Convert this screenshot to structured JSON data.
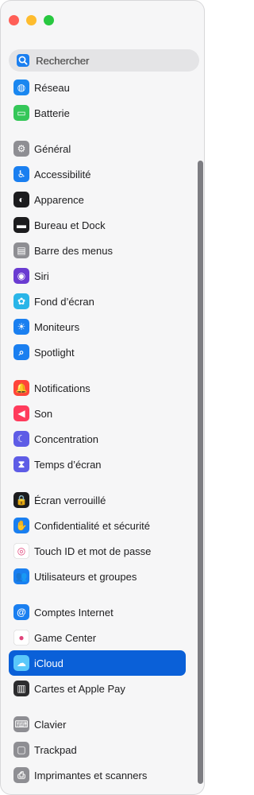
{
  "search": {
    "placeholder": "Rechercher",
    "icon": "magnifier-icon"
  },
  "groups": [
    [
      {
        "name": "reseau",
        "label": "Réseau",
        "icon": "globe-icon",
        "color": "#1a87f0"
      },
      {
        "name": "batterie",
        "label": "Batterie",
        "icon": "battery-icon",
        "color": "#35c759"
      }
    ],
    [
      {
        "name": "general",
        "label": "Général",
        "icon": "gear-icon",
        "color": "#8e8e93"
      },
      {
        "name": "accessibilite",
        "label": "Accessibilité",
        "icon": "accessibility-icon",
        "color": "#1a7ff0"
      },
      {
        "name": "apparence",
        "label": "Apparence",
        "icon": "appearance-icon",
        "color": "#1c1c1e"
      },
      {
        "name": "bureau-et-dock",
        "label": "Bureau et Dock",
        "icon": "dock-icon",
        "color": "#1c1c1e"
      },
      {
        "name": "barre-des-menus",
        "label": "Barre des menus",
        "icon": "menubar-icon",
        "color": "#8e8e93"
      },
      {
        "name": "siri",
        "label": "Siri",
        "icon": "siri-icon",
        "color": "#6a3bd1"
      },
      {
        "name": "fond-d-ecran",
        "label": "Fond d’écran",
        "icon": "wallpaper-icon",
        "color": "#2ab5e8"
      },
      {
        "name": "moniteurs",
        "label": "Moniteurs",
        "icon": "sun-icon",
        "color": "#1a7ff0"
      },
      {
        "name": "spotlight",
        "label": "Spotlight",
        "icon": "search-icon",
        "color": "#1a7ff0"
      }
    ],
    [
      {
        "name": "notifications",
        "label": "Notifications",
        "icon": "bell-icon",
        "color": "#ff453a"
      },
      {
        "name": "son",
        "label": "Son",
        "icon": "speaker-icon",
        "color": "#ff3b5c"
      },
      {
        "name": "concentration",
        "label": "Concentration",
        "icon": "moon-icon",
        "color": "#5e5ce6"
      },
      {
        "name": "temps-d-ecran",
        "label": "Temps d’écran",
        "icon": "hourglass-icon",
        "color": "#5e5ce6"
      }
    ],
    [
      {
        "name": "ecran-verrouille",
        "label": "Écran verrouillé",
        "icon": "lock-icon",
        "color": "#1c1c1e"
      },
      {
        "name": "confidentialite",
        "label": "Confidentialité et sécurité",
        "icon": "hand-icon",
        "color": "#1a7ff0"
      },
      {
        "name": "touch-id",
        "label": "Touch ID et mot de passe",
        "icon": "fingerprint-icon",
        "color": "#ffffff"
      },
      {
        "name": "utilisateurs",
        "label": "Utilisateurs et groupes",
        "icon": "users-icon",
        "color": "#1a7ff0"
      }
    ],
    [
      {
        "name": "comptes-internet",
        "label": "Comptes Internet",
        "icon": "at-icon",
        "color": "#1a7ff0"
      },
      {
        "name": "game-center",
        "label": "Game Center",
        "icon": "game-center-icon",
        "color": "#ffffff"
      },
      {
        "name": "icloud",
        "label": "iCloud",
        "icon": "cloud-icon",
        "color": "#5ac8fa",
        "selected": true
      },
      {
        "name": "cartes-apple-pay",
        "label": "Cartes et Apple Pay",
        "icon": "wallet-icon",
        "color": "#2c2c2e"
      }
    ],
    [
      {
        "name": "clavier",
        "label": "Clavier",
        "icon": "keyboard-icon",
        "color": "#8e8e93"
      },
      {
        "name": "trackpad",
        "label": "Trackpad",
        "icon": "trackpad-icon",
        "color": "#8e8e93"
      },
      {
        "name": "imprimantes",
        "label": "Imprimantes et scanners",
        "icon": "printer-icon",
        "color": "#8e8e93"
      }
    ]
  ]
}
